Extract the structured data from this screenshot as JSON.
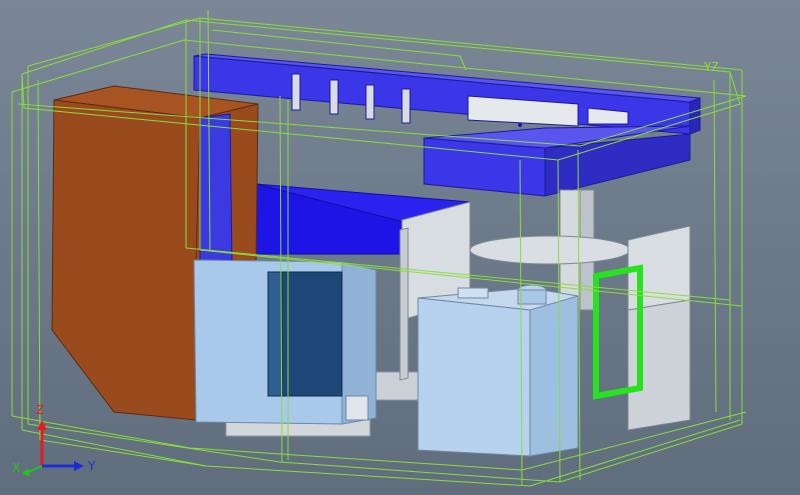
{
  "viewport": {
    "background": "#6f7c8c",
    "corner_label": "YZ",
    "colors": {
      "bounding_box": "#8bdc3c",
      "hopper": "#9a4b1e",
      "frame_blue": "#3a3ae0",
      "panel_light_blue": "#a7c8ea",
      "panel_gray": "#d6dbe0",
      "window_dark": "#1e4a7a",
      "green_frame": "#27e21e"
    }
  },
  "triad": {
    "x_label": "X",
    "y_label": "Y",
    "z_label": "Z",
    "x_color": "#22c622",
    "y_color": "#1d2bd8",
    "z_color": "#e01e1e"
  }
}
